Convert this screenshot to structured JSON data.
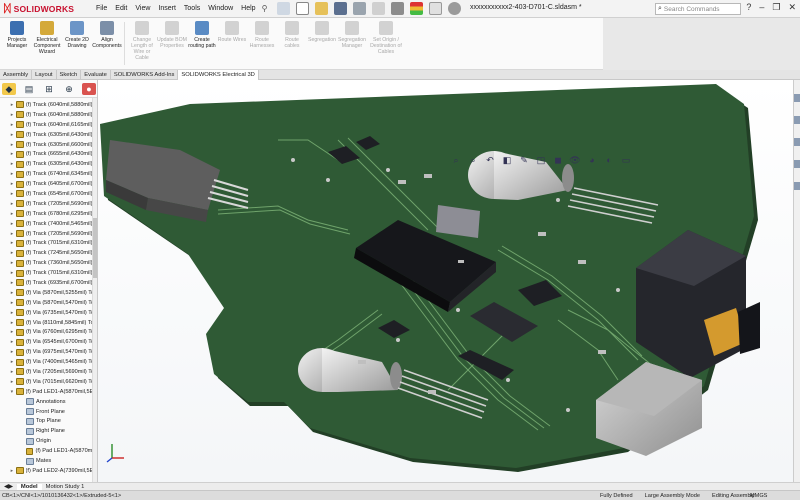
{
  "app": {
    "brand": "SOLIDWORKS",
    "menus": [
      "File",
      "Edit",
      "View",
      "Insert",
      "Tools",
      "Window",
      "Help"
    ],
    "doc_title": "xxxxxxxxxxx2-403-D701-C.sldasm *",
    "search_placeholder": "Search Commands"
  },
  "ribbon": {
    "buttons": [
      {
        "label": "Projects Manager",
        "enabled": true
      },
      {
        "label": "Electrical Component Wizard",
        "enabled": true
      },
      {
        "label": "Create 2D Drawing",
        "enabled": true
      },
      {
        "label": "Align Components",
        "enabled": true
      },
      {
        "label": "Change Length of Wire or Cable",
        "enabled": false
      },
      {
        "label": "Update BOM Properties",
        "enabled": false
      },
      {
        "label": "Create routing path",
        "enabled": true
      },
      {
        "label": "Route Wires",
        "enabled": false
      },
      {
        "label": "Route Harnesses",
        "enabled": false
      },
      {
        "label": "Route cables",
        "enabled": false
      },
      {
        "label": "Segregation",
        "enabled": false
      },
      {
        "label": "Segregation Manager",
        "enabled": false
      },
      {
        "label": "Set Origin / Destination of Cables",
        "enabled": false
      }
    ]
  },
  "command_tabs": [
    "Assembly",
    "Layout",
    "Sketch",
    "Evaluate",
    "SOLIDWORKS Add-Ins",
    "SOLIDWORKS Electrical 3D"
  ],
  "active_command_tab": "SOLIDWORKS Electrical 3D",
  "tree": {
    "items": [
      {
        "label": "(f) Track (6040mil,5880mil)(6",
        "kind": "part"
      },
      {
        "label": "(f) Track (6040mil,5880mil)(6",
        "kind": "part"
      },
      {
        "label": "(f) Track (6040mil,6165mil)(6",
        "kind": "part"
      },
      {
        "label": "(f) Track (6305mil,6430mil)(6",
        "kind": "part"
      },
      {
        "label": "(f) Track (6305mil,6600mil)(6",
        "kind": "part"
      },
      {
        "label": "(f) Track (6655mil,6430mil)(6",
        "kind": "part"
      },
      {
        "label": "(f) Track (6305mil,6430mil)(6",
        "kind": "part"
      },
      {
        "label": "(f) Track (6740mil,6345mil)(6",
        "kind": "part"
      },
      {
        "label": "(f) Track (6405mil,6700mil)(6",
        "kind": "part"
      },
      {
        "label": "(f) Track (6545mil,6700mil)(6",
        "kind": "part"
      },
      {
        "label": "(f) Track (7205mil,5690mil)(7",
        "kind": "part"
      },
      {
        "label": "(f) Track (6780mil,6295mil)(6",
        "kind": "part"
      },
      {
        "label": "(f) Track (7400mil,5465mil)(7",
        "kind": "part"
      },
      {
        "label": "(f) Track (7205mil,5690mil)(7",
        "kind": "part"
      },
      {
        "label": "(f) Track (7015mil,6310mil)(7",
        "kind": "part"
      },
      {
        "label": "(f) Track (7245mil,5650mil)(7",
        "kind": "part"
      },
      {
        "label": "(f) Track (7360mil,5650mil)(7",
        "kind": "part"
      },
      {
        "label": "(f) Track (7015mil,6310mil)(7",
        "kind": "part"
      },
      {
        "label": "(f) Track (6935mil,6700mil)(6",
        "kind": "part"
      },
      {
        "label": "(f) Via (5870mil,5255mil) Top",
        "kind": "part"
      },
      {
        "label": "(f) Via (5870mil,5470mil) Top",
        "kind": "part"
      },
      {
        "label": "(f) Via (6735mil,5470mil) Top",
        "kind": "part"
      },
      {
        "label": "(f) Via (8110mil,5845mil) Top",
        "kind": "part"
      },
      {
        "label": "(f) Via (6760mil,6295mil) Top",
        "kind": "part"
      },
      {
        "label": "(f) Via (6545mil,6700mil) Top",
        "kind": "part"
      },
      {
        "label": "(f) Via (6975mil,5470mil) Top",
        "kind": "part"
      },
      {
        "label": "(f) Via (7400mil,5465mil) Top",
        "kind": "part"
      },
      {
        "label": "(f) Via (7205mil,5690mil) Top",
        "kind": "part"
      },
      {
        "label": "(f) Via (7015mil,6620mil) Top",
        "kind": "part"
      },
      {
        "label": "(f) Pad LED1-A(5870mil,5E15",
        "kind": "part",
        "expanded": true
      },
      {
        "label": "Annotations",
        "kind": "plain",
        "indent": 1
      },
      {
        "label": "Front Plane",
        "kind": "plain",
        "indent": 1
      },
      {
        "label": "Top Plane",
        "kind": "plain",
        "indent": 1
      },
      {
        "label": "Right Plane",
        "kind": "plain",
        "indent": 1
      },
      {
        "label": "Origin",
        "kind": "plain",
        "indent": 1
      },
      {
        "label": "(f) Pad LED1-A(5870mil,5",
        "kind": "part",
        "indent": 1
      },
      {
        "label": "Mates",
        "kind": "plain",
        "indent": 1
      },
      {
        "label": "(f) Pad LED2-A(7390mil,5E15",
        "kind": "part"
      }
    ]
  },
  "bottom_tabs": [
    "Model",
    "Motion Study 1"
  ],
  "active_bottom_tab": "Model",
  "status": {
    "path": "CB<1>/CNI<1>/1010136432<1>/Extruded-5<1>",
    "state": "Fully Defined",
    "mode": "Large Assembly Mode",
    "editing": "Editing Assembly",
    "units": "MMGS"
  },
  "colors": {
    "pcb_green": "#2f5a35",
    "trace_green": "#6fa36b",
    "chip_black": "#1e1f24",
    "accent_red": "#c8102e"
  }
}
